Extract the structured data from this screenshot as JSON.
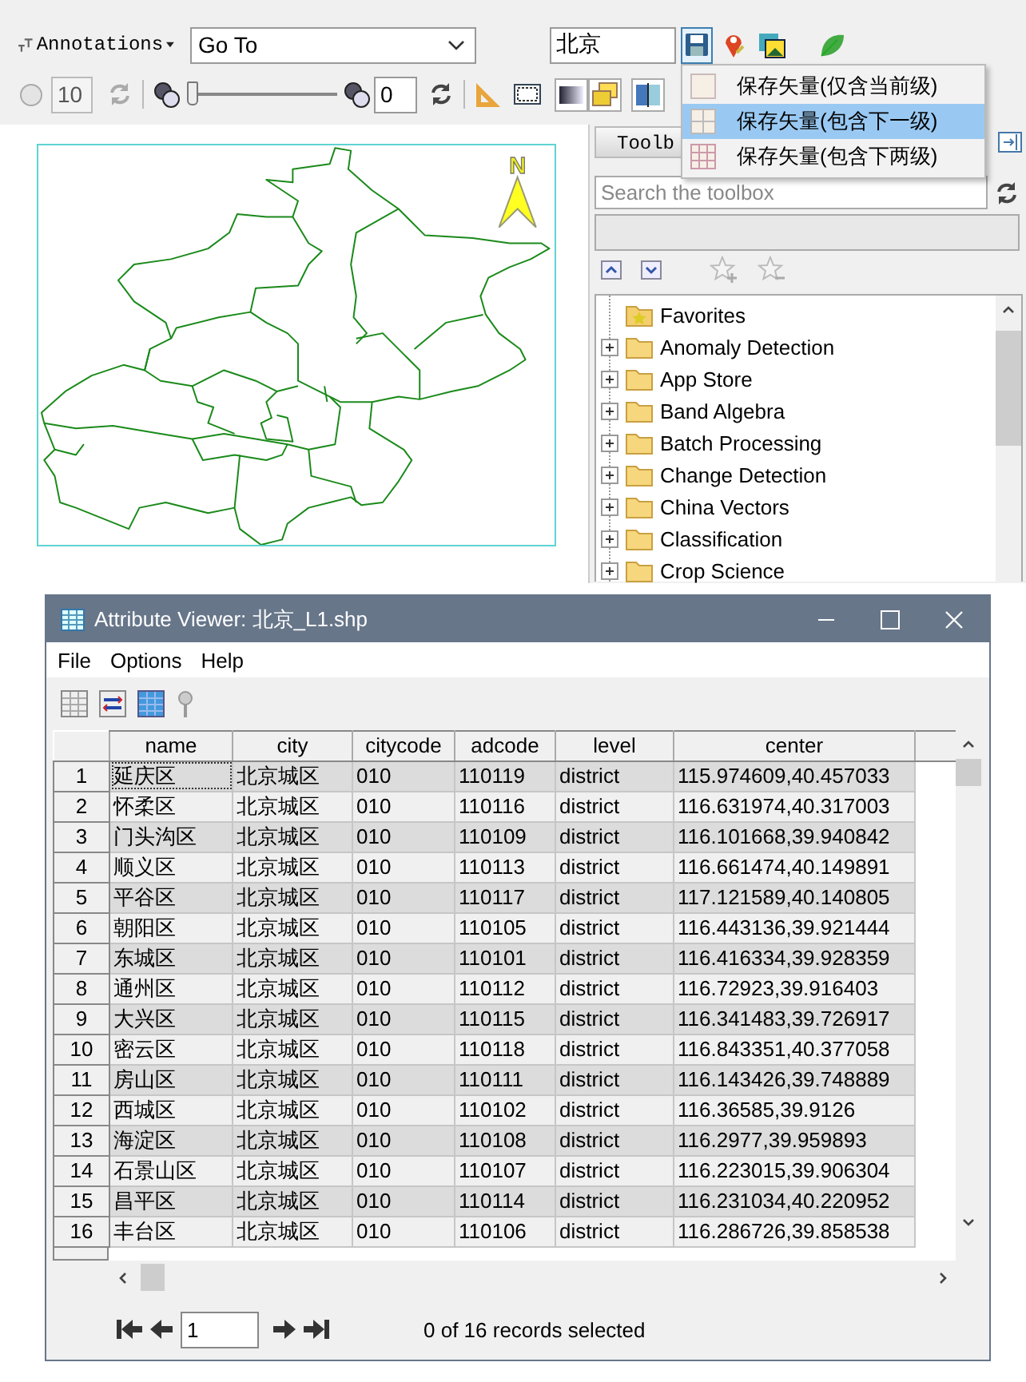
{
  "toolbar": {
    "annotations_label": "Annotations",
    "goto": {
      "value": "Go To"
    },
    "location": {
      "value": "北京"
    },
    "save_pressed": true,
    "size": {
      "value": "10",
      "disabled": true
    },
    "opacity": {
      "level": 0
    },
    "opacity_value": {
      "value": "0"
    }
  },
  "save_menu": [
    {
      "label": "保存矢量(仅含当前级)",
      "kind": "single",
      "selected": false
    },
    {
      "label": "保存矢量(包含下一级)",
      "kind": "grid2",
      "selected": true
    },
    {
      "label": "保存矢量(包含下两级)",
      "kind": "grid3",
      "selected": false
    }
  ],
  "map": {
    "north_label": "N"
  },
  "toolbox": {
    "tab_label": "Toolb",
    "search": {
      "placeholder": "Search the toolbox"
    },
    "tree": [
      {
        "label": "Favorites",
        "kind": "favorites"
      },
      {
        "label": "Anomaly Detection",
        "kind": "category",
        "expanded": false
      },
      {
        "label": "App Store",
        "kind": "category",
        "expanded": false
      },
      {
        "label": "Band Algebra",
        "kind": "category",
        "expanded": false
      },
      {
        "label": "Batch Processing",
        "kind": "category",
        "expanded": false
      },
      {
        "label": "Change Detection",
        "kind": "category",
        "expanded": false
      },
      {
        "label": "China Vectors",
        "kind": "category",
        "expanded": false
      },
      {
        "label": "Classification",
        "kind": "category",
        "expanded": false
      },
      {
        "label": "Crop Science",
        "kind": "category",
        "expanded": false
      }
    ]
  },
  "attribute_viewer": {
    "title": "Attribute Viewer: 北京_L1.shp",
    "menu": [
      "File",
      "Options",
      "Help"
    ],
    "table": {
      "columns": [
        "name",
        "city",
        "citycode",
        "adcode",
        "level",
        "center"
      ],
      "rows": [
        {
          "number": "1",
          "focused": true,
          "cells": [
            "延庆区",
            "北京城区",
            "010",
            "110119",
            "district",
            "115.974609,40.457033"
          ]
        },
        {
          "number": "2",
          "focused": false,
          "cells": [
            "怀柔区",
            "北京城区",
            "010",
            "110116",
            "district",
            "116.631974,40.317003"
          ]
        },
        {
          "number": "3",
          "focused": false,
          "cells": [
            "门头沟区",
            "北京城区",
            "010",
            "110109",
            "district",
            "116.101668,39.940842"
          ]
        },
        {
          "number": "4",
          "focused": false,
          "cells": [
            "顺义区",
            "北京城区",
            "010",
            "110113",
            "district",
            "116.661474,40.149891"
          ]
        },
        {
          "number": "5",
          "focused": false,
          "cells": [
            "平谷区",
            "北京城区",
            "010",
            "110117",
            "district",
            "117.121589,40.140805"
          ]
        },
        {
          "number": "6",
          "focused": false,
          "cells": [
            "朝阳区",
            "北京城区",
            "010",
            "110105",
            "district",
            "116.443136,39.921444"
          ]
        },
        {
          "number": "7",
          "focused": false,
          "cells": [
            "东城区",
            "北京城区",
            "010",
            "110101",
            "district",
            "116.416334,39.928359"
          ]
        },
        {
          "number": "8",
          "focused": false,
          "cells": [
            "通州区",
            "北京城区",
            "010",
            "110112",
            "district",
            "116.72923,39.916403"
          ]
        },
        {
          "number": "9",
          "focused": false,
          "cells": [
            "大兴区",
            "北京城区",
            "010",
            "110115",
            "district",
            "116.341483,39.726917"
          ]
        },
        {
          "number": "10",
          "focused": false,
          "cells": [
            "密云区",
            "北京城区",
            "010",
            "110118",
            "district",
            "116.843351,40.377058"
          ]
        },
        {
          "number": "11",
          "focused": false,
          "cells": [
            "房山区",
            "北京城区",
            "010",
            "110111",
            "district",
            "116.143426,39.748889"
          ]
        },
        {
          "number": "12",
          "focused": false,
          "cells": [
            "西城区",
            "北京城区",
            "010",
            "110102",
            "district",
            "116.36585,39.9126"
          ]
        },
        {
          "number": "13",
          "focused": false,
          "cells": [
            "海淀区",
            "北京城区",
            "010",
            "110108",
            "district",
            "116.2977,39.959893"
          ]
        },
        {
          "number": "14",
          "focused": false,
          "cells": [
            "石景山区",
            "北京城区",
            "010",
            "110107",
            "district",
            "116.223015,39.906304"
          ]
        },
        {
          "number": "15",
          "focused": false,
          "cells": [
            "昌平区",
            "北京城区",
            "010",
            "110114",
            "district",
            "116.231034,40.220952"
          ]
        },
        {
          "number": "16",
          "focused": false,
          "cells": [
            "丰台区",
            "北京城区",
            "010",
            "110106",
            "district",
            "116.286726,39.858538"
          ]
        }
      ]
    },
    "pager": {
      "page": "1"
    },
    "status": "0 of 16 records selected"
  }
}
